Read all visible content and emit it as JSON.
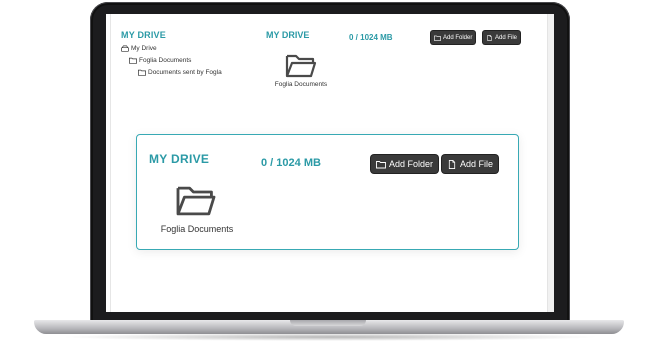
{
  "tree": {
    "title": "MY DRIVE",
    "items": [
      {
        "label": "My Drive",
        "icon": "drive-icon"
      },
      {
        "label": "Foglia Documents",
        "icon": "folder-icon"
      },
      {
        "label": "Documents sent by Fogla",
        "icon": "folder-icon"
      }
    ]
  },
  "drive_small": {
    "title": "MY DRIVE",
    "usage": "0 / 1024 MB",
    "add_folder_label": "Add Folder",
    "add_file_label": "Add File",
    "folder_name": "Foglia Documents"
  },
  "drive_card": {
    "title": "MY DRIVE",
    "usage": "0 / 1024 MB",
    "add_folder_label": "Add Folder",
    "add_file_label": "Add File",
    "folder_name": "Foglia Documents"
  },
  "colors": {
    "accent": "#2b9aa6",
    "button_bg": "#3a3a3a",
    "laptop_bezel": "#1c1c1e"
  }
}
